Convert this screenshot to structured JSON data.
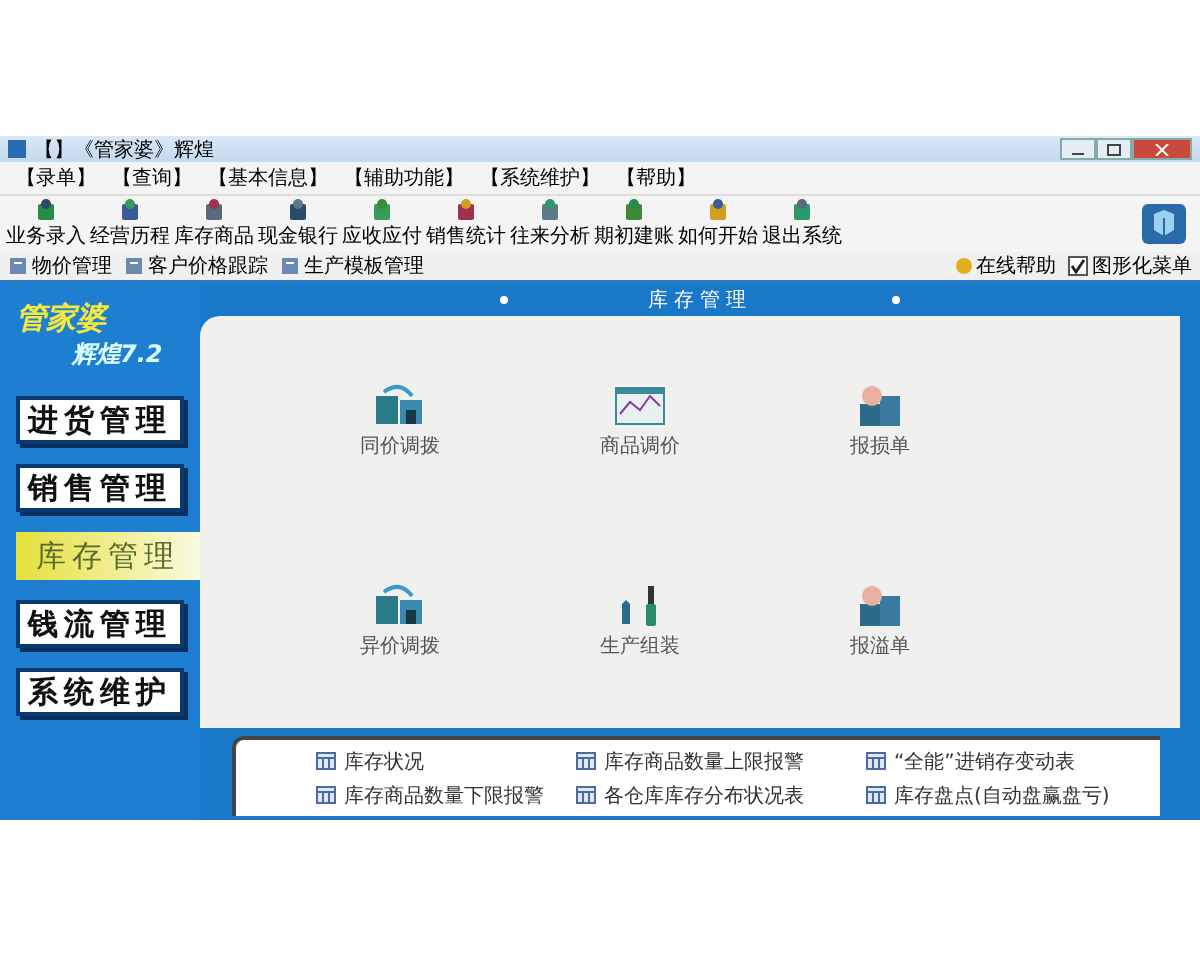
{
  "window": {
    "title": "【】《管家婆》辉煌"
  },
  "menu": [
    "【录单】",
    "【查询】",
    "【基本信息】",
    "【辅助功能】",
    "【系统维护】",
    "【帮助】"
  ],
  "toolbar": [
    {
      "label": "业务录入"
    },
    {
      "label": "经营历程"
    },
    {
      "label": "库存商品"
    },
    {
      "label": "现金银行"
    },
    {
      "label": "应收应付"
    },
    {
      "label": "销售统计"
    },
    {
      "label": "往来分析"
    },
    {
      "label": "期初建账"
    },
    {
      "label": "如何开始"
    },
    {
      "label": "退出系统"
    }
  ],
  "quickbar": [
    "物价管理",
    "客户价格跟踪",
    "生产模板管理"
  ],
  "help": {
    "label": "在线帮助"
  },
  "graphic_menu": {
    "label": "图形化菜单",
    "checked": true
  },
  "logo": {
    "name": "管家婆",
    "edition": "辉煌7.2"
  },
  "sidebar": [
    {
      "label": "进货管理",
      "selected": false
    },
    {
      "label": "销售管理",
      "selected": false
    },
    {
      "label": "库存管理",
      "selected": true
    },
    {
      "label": "钱流管理",
      "selected": false
    },
    {
      "label": "系统维护",
      "selected": false
    }
  ],
  "header": "库存管理",
  "functions": [
    {
      "label": "同价调拨",
      "kind": "transfer"
    },
    {
      "label": "商品调价",
      "kind": "price"
    },
    {
      "label": "报损单",
      "kind": "report"
    },
    {
      "label": "异价调拨",
      "kind": "transfer"
    },
    {
      "label": "生产组装",
      "kind": "tools"
    },
    {
      "label": "报溢单",
      "kind": "report"
    }
  ],
  "reports": [
    "库存状况",
    "库存商品数量上限报警",
    "“全能”进销存变动表",
    "库存商品数量下限报警",
    "各仓库库存分布状况表",
    "库存盘点(自动盘赢盘亏)"
  ]
}
